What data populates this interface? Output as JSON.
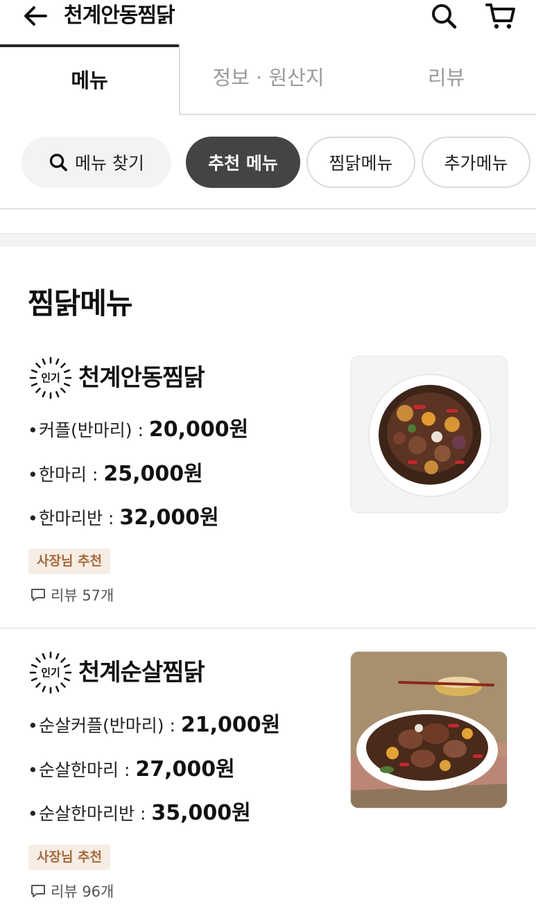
{
  "header": {
    "title": "천계안동찜닭",
    "icons": {
      "back": "arrow-left-icon",
      "search": "search-icon",
      "cart": "cart-icon"
    }
  },
  "tabs": [
    {
      "label": "메뉴",
      "active": true
    },
    {
      "label": "정보 · 원산지",
      "active": false
    },
    {
      "label": "리뷰",
      "active": false
    }
  ],
  "filters": {
    "search_label": "메뉴 찾기",
    "chips": [
      {
        "label": "추천 메뉴",
        "active": true
      },
      {
        "label": "찜닭메뉴",
        "active": false
      },
      {
        "label": "추가메뉴",
        "active": false
      }
    ]
  },
  "section": {
    "title": "찜닭메뉴"
  },
  "items": [
    {
      "badge": "인기",
      "name": "천계안동찜닭",
      "prices": [
        {
          "label": "커플(반마리) :",
          "amount": "20,000원"
        },
        {
          "label": "한마리 :",
          "amount": "25,000원"
        },
        {
          "label": "한마리반 :",
          "amount": "32,000원"
        }
      ],
      "recommend": "사장님 추천",
      "review": "리뷰 57개"
    },
    {
      "badge": "인기",
      "name": "천계순살찜닭",
      "prices": [
        {
          "label": "순살커플(반마리) :",
          "amount": "21,000원"
        },
        {
          "label": "순살한마리 :",
          "amount": "27,000원"
        },
        {
          "label": "순살한마리반 :",
          "amount": "35,000원"
        }
      ],
      "recommend": "사장님 추천",
      "review": "리뷰 96개"
    }
  ],
  "colors": {
    "active_chip": "#444444",
    "recommend_bg": "#f6ede4",
    "recommend_text": "#a5693f",
    "inactive_tab_text": "#9a9a9a"
  }
}
